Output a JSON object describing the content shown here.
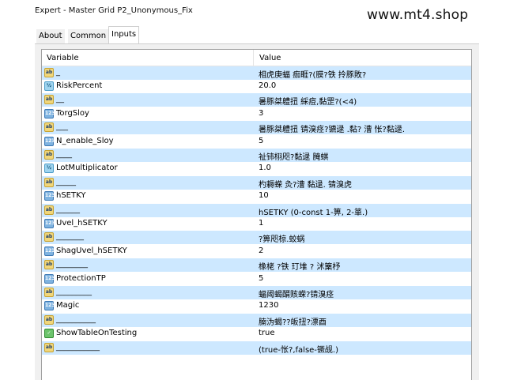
{
  "window": {
    "title": "Expert - Master Grid P2_Unonymous_Fix"
  },
  "watermark": "www.mt4.shop",
  "tabs": [
    {
      "label": "About"
    },
    {
      "label": "Common"
    },
    {
      "label": "Inputs",
      "active": true
    }
  ],
  "grid": {
    "header_variable": "Variable",
    "header_value": "Value",
    "rows": [
      {
        "icon": "ab",
        "name": "_",
        "value": "相虎庚蝠 痂睚?(膜?铁 拎豚敗?"
      },
      {
        "icon": "frac",
        "name": "RiskPercent",
        "value": "20.0"
      },
      {
        "icon": "ab",
        "name": "__",
        "value": "暑豚桀軆扭 綵痘,黏罡?(<4)"
      },
      {
        "icon": "num",
        "name": "TorgSloy",
        "value": "3"
      },
      {
        "icon": "ab",
        "name": "___",
        "value": "暑豚桀軆扭 锖溴痉?镳逯   .黏? 漕 怅?黏逯."
      },
      {
        "icon": "num",
        "name": "N_enable_Sloy",
        "value": "5"
      },
      {
        "icon": "ab",
        "name": "____",
        "value": "祉铈栩咫?黏逯 腌蜞"
      },
      {
        "icon": "frac",
        "name": "LotMultiplicator",
        "value": "1.0"
      },
      {
        "icon": "ab",
        "name": "_____",
        "value": "杓耨蝾    灸?漕 黏逯. 锖溴虎"
      },
      {
        "icon": "num",
        "name": "hSETKY",
        "value": "10"
      },
      {
        "icon": "ab",
        "name": "______",
        "value": "hSETKY (0-const 1-箅, 2-箪.)"
      },
      {
        "icon": "num",
        "name": "Uvel_hSETKY",
        "value": "1"
      },
      {
        "icon": "ab",
        "name": "_______",
        "value": "   ?箅咫椋.蛟蜗"
      },
      {
        "icon": "num",
        "name": "ShagUvel_hSETKY",
        "value": "2"
      },
      {
        "icon": "ab",
        "name": "________",
        "value": "橡栳    ?铁 玎堆    ? 沭篥杼"
      },
      {
        "icon": "num",
        "name": "ProtectionTP",
        "value": "5"
      },
      {
        "icon": "ab",
        "name": "_________",
        "value": "蝠阈蝎醑赅蝾?锖溴痉"
      },
      {
        "icon": "num",
        "name": "Magic",
        "value": "1230"
      },
      {
        "icon": "ab",
        "name": "__________",
        "value": "腩沩蝎??皈扭?漂酉"
      },
      {
        "icon": "bool",
        "name": "ShowTableOnTesting",
        "value": "true"
      },
      {
        "icon": "ab",
        "name": "___________",
        "value": "(true-怅?,false-镢觇.)"
      }
    ]
  }
}
